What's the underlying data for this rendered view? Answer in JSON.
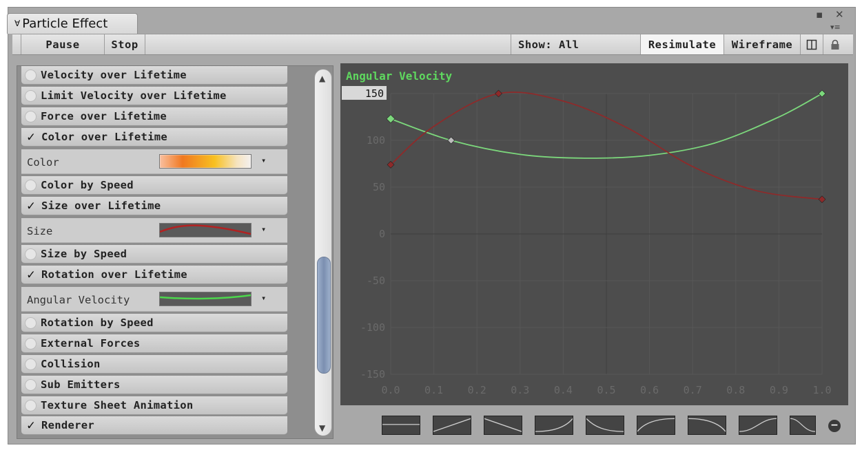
{
  "window": {
    "tab_title": "Particle Effect",
    "maximize_icon": "▪",
    "close_icon": "✕",
    "menu_icon": "▾≡"
  },
  "toolbar": {
    "pause": "Pause",
    "stop": "Stop",
    "show_all": "Show: All",
    "resimulate": "Resimulate",
    "wireframe": "Wireframe"
  },
  "modules": [
    {
      "label": "Velocity over Lifetime",
      "checked": false
    },
    {
      "label": "Limit Velocity over Lifetime",
      "checked": false
    },
    {
      "label": "Force over Lifetime",
      "checked": false
    },
    {
      "label": "Color over Lifetime",
      "checked": true
    },
    {
      "label": "Color by Speed",
      "checked": false
    },
    {
      "label": "Size over Lifetime",
      "checked": true
    },
    {
      "label": "Size by Speed",
      "checked": false
    },
    {
      "label": "Rotation over Lifetime",
      "checked": true
    },
    {
      "label": "Rotation by Speed",
      "checked": false
    },
    {
      "label": "External Forces",
      "checked": false
    },
    {
      "label": "Collision",
      "checked": false
    },
    {
      "label": "Sub Emitters",
      "checked": false
    },
    {
      "label": "Texture Sheet Animation",
      "checked": false
    },
    {
      "label": "Renderer",
      "checked": true
    }
  ],
  "props": {
    "color": "Color",
    "size": "Size",
    "angular_velocity": "Angular Velocity"
  },
  "checkmark": "✓",
  "dropdown_arrow": "▾",
  "curve_editor": {
    "title": "Angular Velocity",
    "max_value": "150",
    "y_ticks": [
      "100",
      "50",
      "0",
      "-50",
      "-100",
      "-150"
    ],
    "x_ticks": [
      "0.0",
      "0.1",
      "0.2",
      "0.3",
      "0.4",
      "0.5",
      "0.6",
      "0.7",
      "0.8",
      "0.9",
      "1.0"
    ],
    "remove_icon": "−"
  },
  "chart_data": {
    "type": "line",
    "title": "Angular Velocity",
    "xlim": [
      0,
      1
    ],
    "ylim": [
      -150,
      150
    ],
    "grid": true,
    "series": [
      {
        "color": "#7cd87c",
        "x": [
          0.0,
          0.14,
          0.3,
          0.45,
          0.6,
          0.75,
          0.9,
          1.0
        ],
        "y": [
          123,
          100,
          85,
          81,
          84,
          97,
          125,
          150
        ]
      },
      {
        "color": "#8e2a2a",
        "x": [
          0.0,
          0.1,
          0.25,
          0.4,
          0.55,
          0.7,
          0.85,
          1.0
        ],
        "y": [
          74,
          115,
          150,
          142,
          113,
          72,
          46,
          37
        ]
      }
    ]
  },
  "colors": {
    "curve_green": "#7cd87c",
    "curve_red": "#8e2a2a",
    "title_green": "#5fd85f",
    "scroll_thumb": "#7b8fb0"
  }
}
